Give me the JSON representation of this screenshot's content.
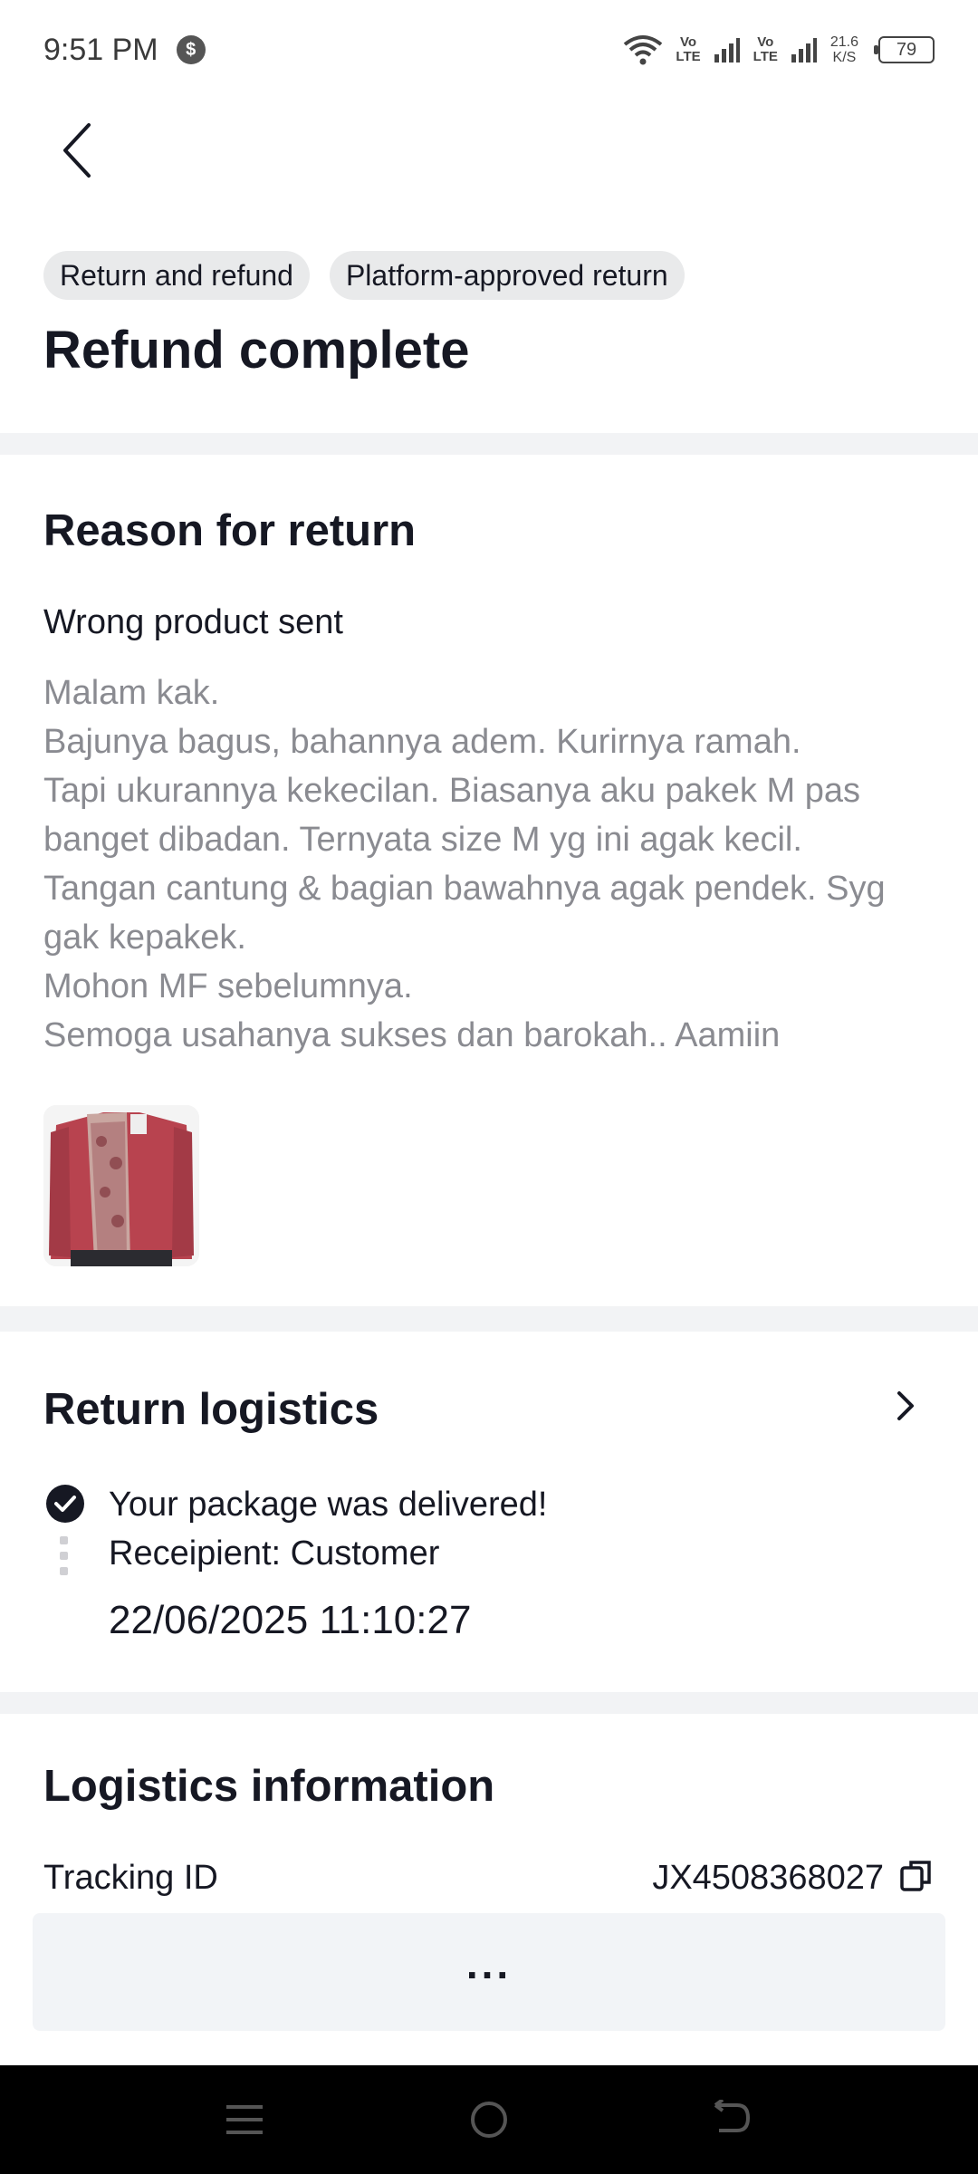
{
  "status_bar": {
    "time": "9:51 PM",
    "badge_glyph": "$",
    "volte_1": [
      "Vo",
      "LTE"
    ],
    "volte_2": [
      "Vo",
      "LTE"
    ],
    "speed": [
      "21.6",
      "K/S"
    ],
    "battery": "79"
  },
  "header": {
    "tags": [
      "Return and refund",
      "Platform-approved return"
    ],
    "status": "Refund complete"
  },
  "reason": {
    "section_title": "Reason for return",
    "type": "Wrong product sent",
    "description_lines": [
      "Malam kak.",
      "Bajunya bagus, bahannya adem. Kurirnya ramah.",
      "Tapi ukurannya kekecilan. Biasanya aku pakek M pas",
      "banget dibadan. Ternyata size M yg ini agak kecil.",
      "Tangan cantung & bagian bawahnya agak pendek. Syg",
      "gak kepakek.",
      "Mohon MF sebelumnya.",
      "Semoga usahanya sukses dan barokah.. Aamiin"
    ]
  },
  "return_logistics": {
    "section_title": "Return logistics",
    "status": "Your package was delivered!",
    "recipient": "Receipient: Customer",
    "timestamp": "22/06/2025 11:10:27"
  },
  "logistics_info": {
    "section_title": "Logistics information",
    "tracking_label": "Tracking ID",
    "tracking_value": "JX4508368027"
  },
  "footer": {
    "more_label": "..."
  },
  "colors": {
    "primary_text": "#161823",
    "secondary_text": "#8a8b91",
    "tag_bg": "#e9eaeb",
    "page_bg": "#f2f3f5"
  }
}
